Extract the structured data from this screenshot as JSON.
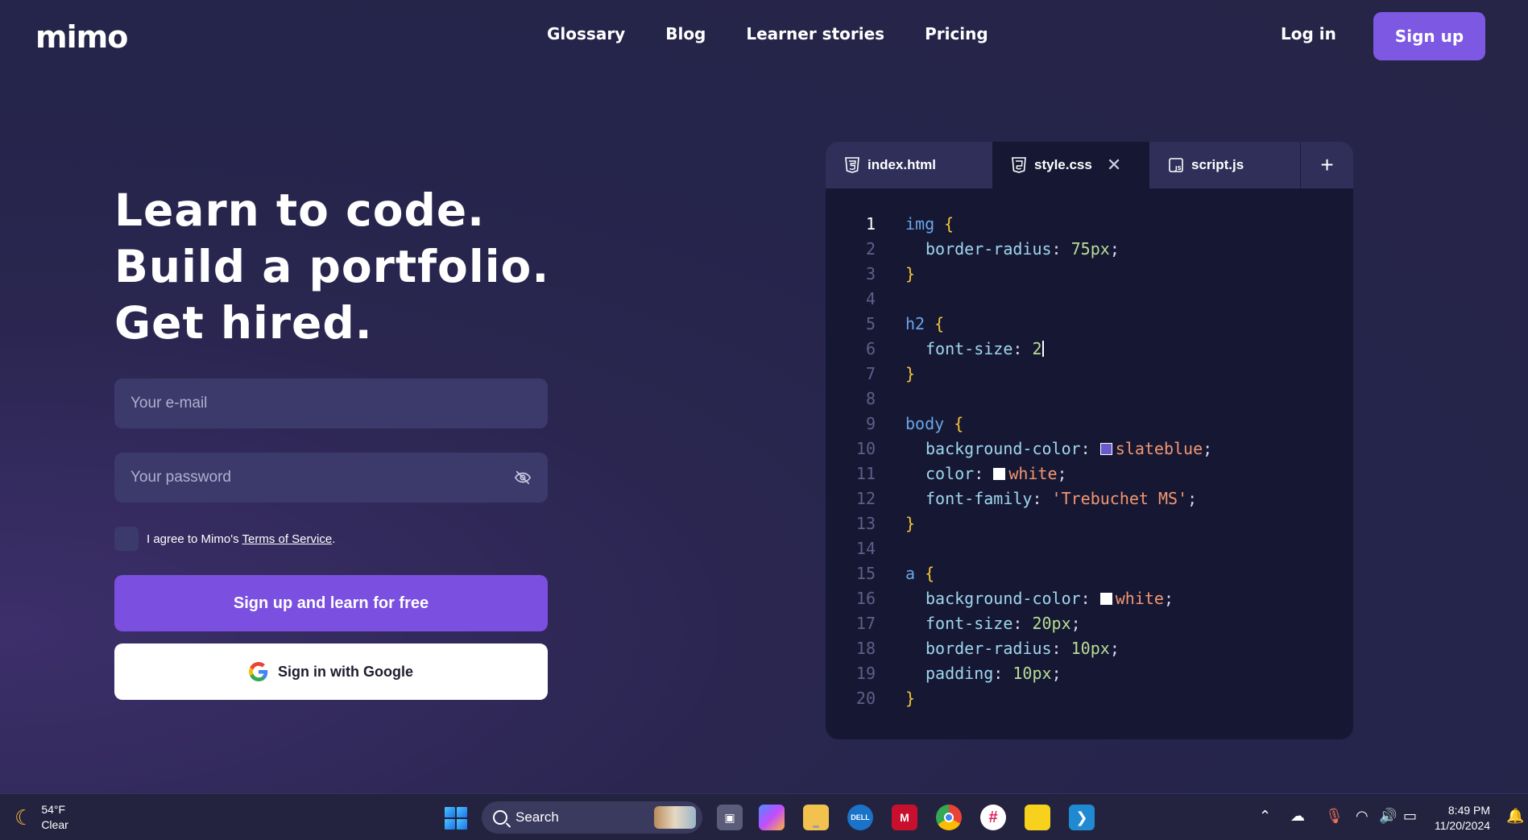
{
  "header": {
    "logo": "mimo",
    "nav": [
      "Glossary",
      "Blog",
      "Learner stories",
      "Pricing"
    ],
    "login": "Log in",
    "signup": "Sign up"
  },
  "hero": {
    "lines": [
      "Learn to code.",
      "Build a portfolio.",
      "Get hired."
    ]
  },
  "form": {
    "email_placeholder": "Your e-mail",
    "password_placeholder": "Your password",
    "agree_prefix": "I agree to Mimo's ",
    "agree_link": "Terms of Service",
    "agree_suffix": ".",
    "primary_button": "Sign up and learn for free",
    "google_button": "Sign in with Google"
  },
  "editor": {
    "tabs": [
      {
        "label": "index.html",
        "icon": "html5-icon"
      },
      {
        "label": "style.css",
        "icon": "css3-icon",
        "active": true
      },
      {
        "label": "script.js",
        "icon": "js-icon"
      }
    ],
    "add_tab": "+",
    "active_line": 1,
    "line_numbers": [
      "1",
      "2",
      "3",
      "4",
      "5",
      "6",
      "7",
      "8",
      "9",
      "10",
      "11",
      "12",
      "13",
      "14",
      "15",
      "16",
      "17",
      "18",
      "19",
      "20"
    ],
    "code": {
      "l1_sel": "img",
      "l2_prop": "border-radius",
      "l2_val": "75px",
      "l5_sel": "h2",
      "l6_prop": "font-size",
      "l6_val": "2",
      "l9_sel": "body",
      "l10_prop": "background-color",
      "l10_val": "slateblue",
      "l10_swatch": "#6a5acd",
      "l11_prop": "color",
      "l11_val": "white",
      "l11_swatch": "#ffffff",
      "l12_prop": "font-family",
      "l12_val": "'Trebuchet MS'",
      "l15_sel": "a",
      "l16_prop": "background-color",
      "l16_val": "white",
      "l16_swatch": "#ffffff",
      "l17_prop": "font-size",
      "l17_val": "20px",
      "l18_prop": "border-radius",
      "l18_val": "10px",
      "l19_prop": "padding",
      "l19_val": "10px"
    }
  },
  "taskbar": {
    "weather_temp": "54°F",
    "weather_desc": "Clear",
    "search_label": "Search",
    "time": "8:49 PM",
    "date": "11/20/2024",
    "apps": [
      "task-view-icon",
      "copilot-icon",
      "file-explorer-icon",
      "dell-icon",
      "mcafee-icon",
      "chrome-icon",
      "slack-icon",
      "sticky-notes-icon",
      "vscode-icon"
    ]
  },
  "colors": {
    "accent": "#7b4fe0",
    "background": "#26254a",
    "editor_bg": "#161833"
  }
}
